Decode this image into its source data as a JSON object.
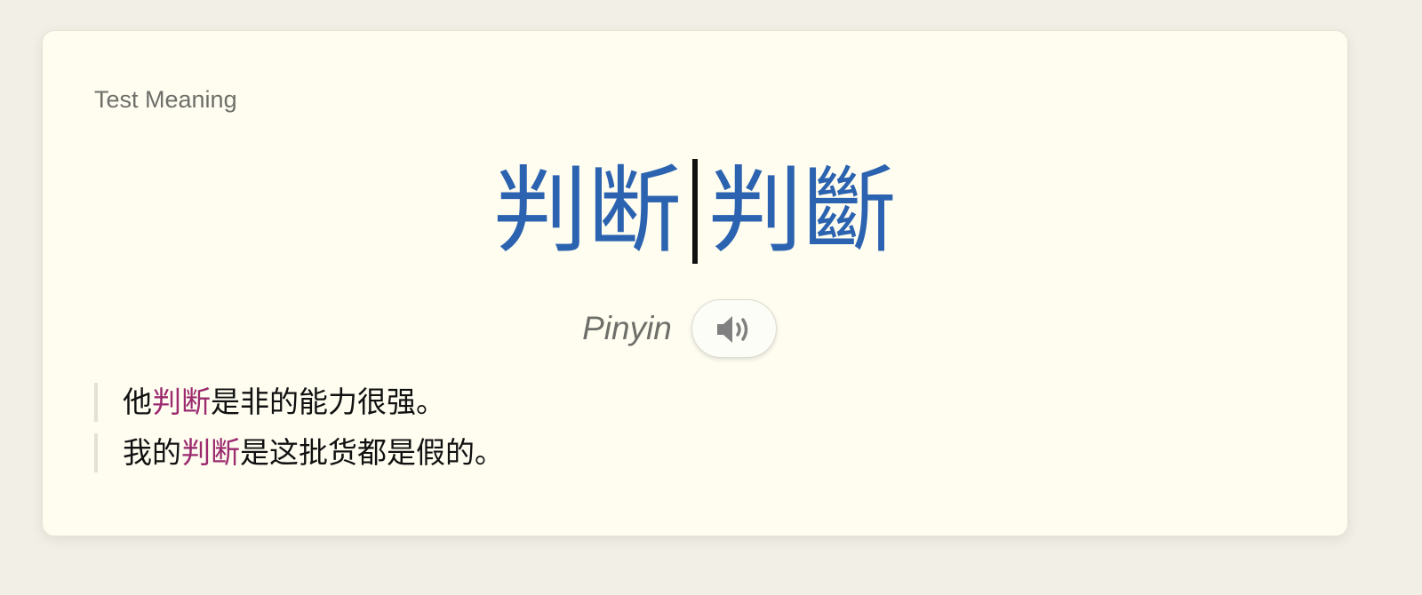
{
  "card": {
    "label": "Test Meaning",
    "headword": {
      "simplified": "判断",
      "traditional": "判斷"
    },
    "pinyin_label": "Pinyin",
    "audio_icon": "speaker-icon",
    "examples": [
      {
        "before": "他",
        "highlight": "判断",
        "after": "是非的能力很强。"
      },
      {
        "before": "我的",
        "highlight": "判断",
        "after": "是这批货都是假的。"
      }
    ]
  },
  "colors": {
    "headword": "#2c63b0",
    "highlight": "#9b2a6e",
    "card_background": "#fefdf0",
    "page_background": "#f2f0e6"
  }
}
